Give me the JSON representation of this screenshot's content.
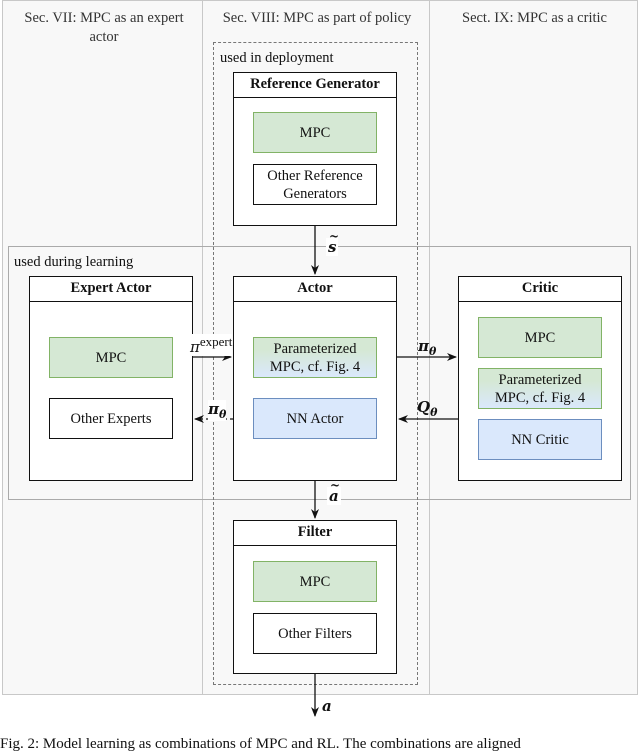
{
  "sections": [
    {
      "id": "expert",
      "title": "Sec. VII: MPC as an expert actor"
    },
    {
      "id": "policy",
      "title": "Sec. VIII: MPC as part of policy"
    },
    {
      "id": "critic",
      "title": "Sect. IX: MPC as a critic"
    }
  ],
  "regions": {
    "deployment_label": "used in deployment",
    "learning_label": "used during learning"
  },
  "containers": {
    "reference_generator": {
      "title": "Reference Generator",
      "items": [
        "MPC",
        "Other Reference Generators"
      ]
    },
    "expert_actor": {
      "title": "Expert Actor",
      "items": [
        "MPC",
        "Other Experts"
      ]
    },
    "actor": {
      "title": "Actor",
      "items": [
        "Parameterized MPC, cf. Fig. 4",
        "NN Actor"
      ]
    },
    "critic": {
      "title": "Critic",
      "items": [
        "MPC",
        "Parameterized MPC, cf. Fig. 4",
        "NN Critic"
      ]
    },
    "filter": {
      "title": "Filter",
      "items": [
        "MPC",
        "Other Filters"
      ]
    }
  },
  "edges": {
    "ref_to_actor": {
      "symbol": "s",
      "accent": "~",
      "from": "Reference Generator",
      "to": "Actor"
    },
    "expert_to_actor": {
      "symbol": "π",
      "superscript": "expert",
      "from": "Expert Actor",
      "to": "Actor",
      "style": "solid"
    },
    "actor_to_expert": {
      "symbol": "π",
      "subscript": "θ",
      "from": "Actor",
      "to": "Expert Actor",
      "style": "dashed"
    },
    "actor_to_critic": {
      "symbol": "π",
      "subscript": "θ",
      "from": "Actor",
      "to": "Critic",
      "style": "solid"
    },
    "critic_to_actor": {
      "symbol": "Q",
      "subscript": "θ",
      "from": "Critic",
      "to": "Actor",
      "style": "solid"
    },
    "actor_to_filter": {
      "symbol": "a",
      "accent": "~",
      "from": "Actor",
      "to": "Filter"
    },
    "filter_output": {
      "symbol": "a",
      "from": "Filter",
      "to": "output"
    }
  },
  "caption": "Fig. 2: Model learning as combinations of MPC and RL. The combinations are aligned"
}
